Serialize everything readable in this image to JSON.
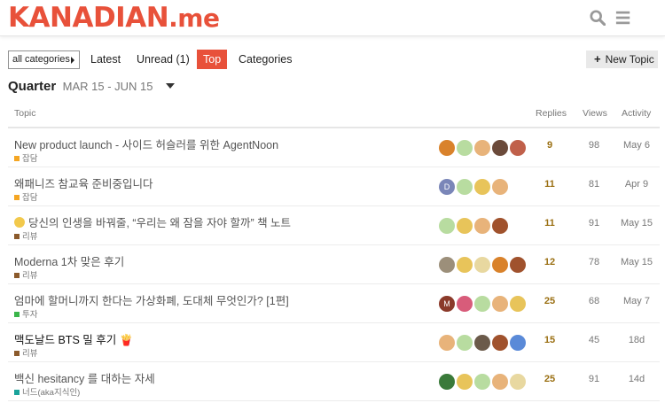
{
  "header": {
    "logo_main": "KANADIAN",
    "logo_suffix": ".me"
  },
  "nav": {
    "category_dropdown": "all categories",
    "latest": "Latest",
    "unread": "Unread (1)",
    "top": "Top",
    "categories": "Categories",
    "new_topic": "New Topic"
  },
  "period": {
    "title": "Quarter",
    "range": "MAR 15 - JUN 15"
  },
  "columns": {
    "topic": "Topic",
    "replies": "Replies",
    "views": "Views",
    "activity": "Activity"
  },
  "topics": [
    {
      "title": "New product launch - 사이드 허슬러를 위한 AgentNoon",
      "category": "잡담",
      "category_color": "#f5a623",
      "replies": "9",
      "views": "98",
      "activity": "May 6",
      "avatars": [
        "#d9822b",
        "#b8dca0",
        "#e8b37a",
        "#6b4a3a",
        "#c0604a"
      ]
    },
    {
      "title": "왜패니즈 참교육 준비중입니다",
      "category": "잡담",
      "category_color": "#f5a623",
      "replies": "11",
      "views": "81",
      "activity": "Apr 9",
      "avatars": [
        "#7a86b8",
        "#b8dca0",
        "#e8c45a",
        "#e8b37a"
      ],
      "avatar_letters": [
        "D"
      ]
    },
    {
      "title": "당신의 인생을 바꿔줄, “우리는 왜 잠을 자야 할까” 책 노트",
      "category": "리뷰",
      "category_color": "#8b5a2b",
      "replies": "11",
      "views": "91",
      "activity": "May 15",
      "avatars": [
        "#b8dca0",
        "#e8c45a",
        "#e8b37a",
        "#a0522d"
      ]
    },
    {
      "title": "Moderna 1차 맞은 후기",
      "category": "리뷰",
      "category_color": "#8b5a2b",
      "replies": "12",
      "views": "78",
      "activity": "May 15",
      "avatars": [
        "#9c8f7a",
        "#e8c45a",
        "#e8d8a0",
        "#d9822b",
        "#a0522d"
      ]
    },
    {
      "title": "엄마에 할머니까지 한다는 가상화폐, 도대체 무엇인가? [1편]",
      "category": "투자",
      "category_color": "#3ab54a",
      "replies": "25",
      "views": "68",
      "activity": "May 7",
      "avatars": [
        "#8b3a2a",
        "#d85c7a",
        "#b8dca0",
        "#e8b37a",
        "#e8c45a"
      ],
      "avatar_letters": [
        "M"
      ]
    },
    {
      "title": "맥도날드 BTS 밀 후기 🍟",
      "category": "리뷰",
      "category_color": "#8b5a2b",
      "replies": "15",
      "views": "45",
      "activity": "18d",
      "avatars": [
        "#e8b37a",
        "#b8dca0",
        "#6b5a4a",
        "#a0522d",
        "#5a8ad8"
      ]
    },
    {
      "title": "백신 hesitancy 를 대하는 자세",
      "category": "너드(aka지식인)",
      "category_color": "#1aa39a",
      "replies": "25",
      "views": "91",
      "activity": "14d",
      "avatars": [
        "#3a7a3a",
        "#e8c45a",
        "#b8dca0",
        "#e8b37a",
        "#e8d8a0"
      ]
    }
  ]
}
